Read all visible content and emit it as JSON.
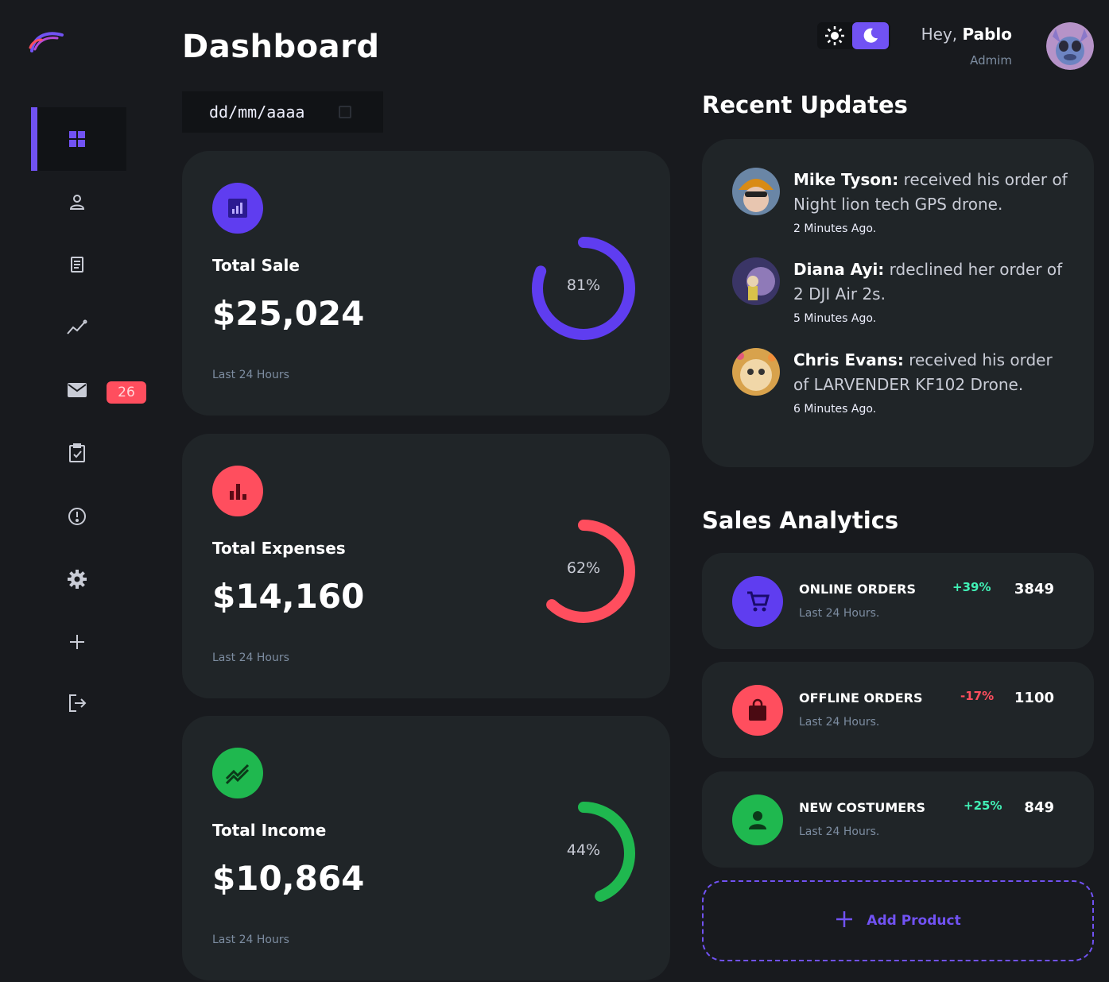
{
  "header": {
    "title": "Dashboard",
    "date_placeholder": "dd/mm/aaaa",
    "greeting": "Hey,",
    "user_name": "Pablo",
    "user_role": "Admim"
  },
  "sidebar": {
    "items": [
      {
        "icon": "grid-icon",
        "active": true
      },
      {
        "icon": "user-icon"
      },
      {
        "icon": "receipt-icon"
      },
      {
        "icon": "insights-icon"
      },
      {
        "icon": "mail-icon",
        "badge": "26"
      },
      {
        "icon": "inventory-icon"
      },
      {
        "icon": "report-icon"
      },
      {
        "icon": "settings-icon"
      },
      {
        "icon": "add-icon"
      },
      {
        "icon": "logout-icon"
      }
    ]
  },
  "cards": [
    {
      "label": "Total Sale",
      "amount": "$25,024",
      "footer": "Last 24 Hours",
      "percent_label": "81%",
      "percent": 81,
      "color": "#5f3df0"
    },
    {
      "label": "Total Expenses",
      "amount": "$14,160",
      "footer": "Last 24 Hours",
      "percent_label": "62%",
      "percent": 62,
      "color": "#ff4e5e"
    },
    {
      "label": "Total Income",
      "amount": "$10,864",
      "footer": "Last 24 Hours",
      "percent_label": "44%",
      "percent": 44,
      "color": "#1fb84f"
    }
  ],
  "recent_updates": {
    "title": "Recent Updates",
    "items": [
      {
        "name": "Mike Tyson:",
        "text": " received his order of Night lion tech GPS drone.",
        "time": "2 Minutes Ago."
      },
      {
        "name": "Diana Ayi:",
        "text": " rdeclined her order of 2 DJI Air 2s.",
        "time": "5 Minutes Ago."
      },
      {
        "name": "Chris Evans:",
        "text": " received his order of LARVENDER KF102 Drone.",
        "time": "6 Minutes Ago."
      }
    ]
  },
  "sales_analytics": {
    "title": "Sales Analytics",
    "items": [
      {
        "name": "ONLINE ORDERS",
        "sub": "Last 24 Hours.",
        "change": "+39%",
        "value": "3849",
        "color": "#5f3df0",
        "change_color": "#41f1b6"
      },
      {
        "name": "OFFLINE ORDERS",
        "sub": "Last 24 Hours.",
        "change": "-17%",
        "value": "1100",
        "color": "#ff4e5e",
        "change_color": "#ff4e5e"
      },
      {
        "name": "NEW COSTUMERS",
        "sub": "Last 24 Hours.",
        "change": "+25%",
        "value": "849",
        "color": "#1fb84f",
        "change_color": "#41f1b6"
      }
    ],
    "add_label": "Add Product"
  },
  "colors": {
    "accent": "#7152f3",
    "danger": "#ff4e5e",
    "success": "#1fb84f",
    "card": "#202528",
    "background": "#181a1e"
  }
}
